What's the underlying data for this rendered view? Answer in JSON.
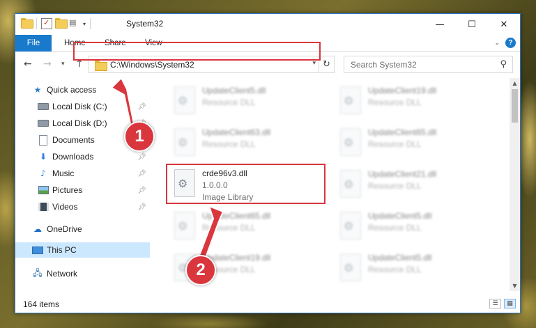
{
  "window": {
    "title": "System32"
  },
  "ribbon": {
    "tabs": [
      "File",
      "Home",
      "Share",
      "View"
    ]
  },
  "address": {
    "path": "C:\\Windows\\System32"
  },
  "search": {
    "placeholder": "Search System32"
  },
  "sidebar": {
    "items": [
      {
        "label": "Quick access",
        "icon": "star-icon",
        "pinned": false
      },
      {
        "label": "Local Disk (C:)",
        "icon": "drive-icon",
        "pinned": true
      },
      {
        "label": "Local Disk (D:)",
        "icon": "drive-icon",
        "pinned": true
      },
      {
        "label": "Documents",
        "icon": "documents-icon",
        "pinned": true
      },
      {
        "label": "Downloads",
        "icon": "downloads-icon",
        "pinned": true
      },
      {
        "label": "Music",
        "icon": "music-icon",
        "pinned": true
      },
      {
        "label": "Pictures",
        "icon": "pictures-icon",
        "pinned": true
      },
      {
        "label": "Videos",
        "icon": "videos-icon",
        "pinned": true
      },
      {
        "label": "OneDrive",
        "icon": "onedrive-icon",
        "pinned": false
      },
      {
        "label": "This PC",
        "icon": "this-pc-icon",
        "pinned": false,
        "selected": true
      },
      {
        "label": "Network",
        "icon": "network-icon",
        "pinned": false
      }
    ]
  },
  "files": {
    "left": [
      {
        "name": "UpdateClient5.dll",
        "type": "Resource DLL"
      },
      {
        "name": "UpdateClient63.dll",
        "type": "Resource DLL"
      },
      {
        "name": "crde96v3.dll",
        "version": "1.0.0.0",
        "type": "Image Library"
      },
      {
        "name": "UpdateClient65.dll",
        "type": "Resource DLL"
      },
      {
        "name": "UpdateClient19.dll",
        "type": "Resource DLL"
      }
    ],
    "right": [
      {
        "name": "UpdateClient19.dll",
        "type": "Resource DLL"
      },
      {
        "name": "UpdateClient65.dll",
        "type": "Resource DLL"
      },
      {
        "name": "UpdateClient21.dll",
        "type": "Resource DLL"
      },
      {
        "name": "UpdateClient5.dll",
        "type": "Resource DLL"
      },
      {
        "name": "UpdateClient5.dll",
        "type": "Resource DLL"
      }
    ]
  },
  "status": {
    "item_count": "164 items"
  },
  "annotations": {
    "step1": "1",
    "step2": "2",
    "color": "#d9363e"
  },
  "colors": {
    "accent": "#1979ca",
    "selection": "#cce8ff"
  }
}
